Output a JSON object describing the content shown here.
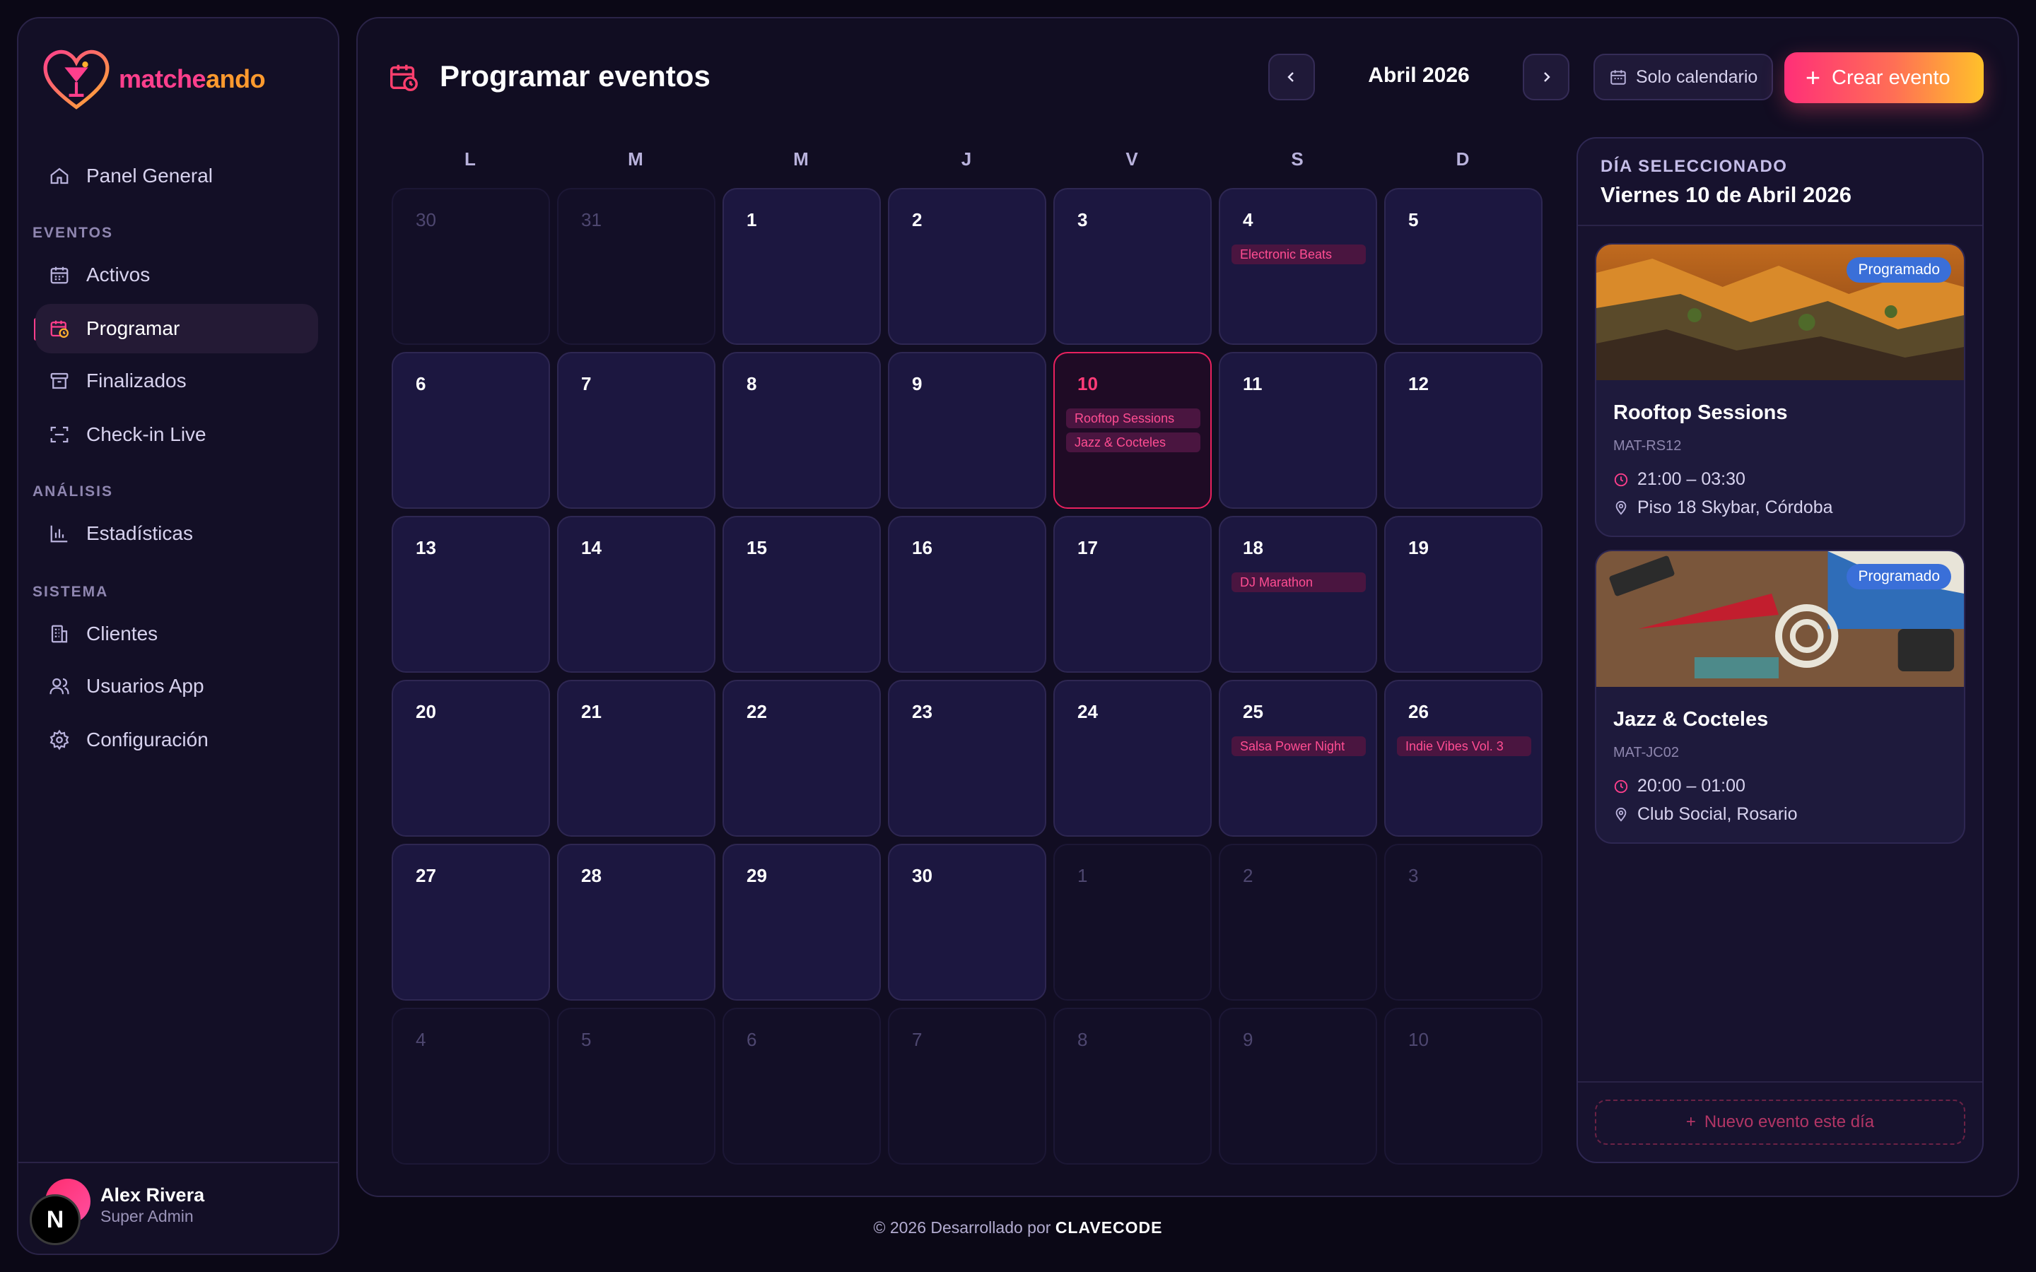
{
  "brand": {
    "name_main": "matche",
    "name_tail": "ando"
  },
  "sidebar": {
    "main_item": "Panel General",
    "sections": [
      {
        "title": "EVENTOS",
        "items": [
          "Activos",
          "Programar",
          "Finalizados",
          "Check-in Live"
        ]
      },
      {
        "title": "ANÁLISIS",
        "items": [
          "Estadísticas"
        ]
      },
      {
        "title": "SISTEMA",
        "items": [
          "Clientes",
          "Usuarios App",
          "Configuración"
        ]
      }
    ],
    "active_item": "Programar",
    "user": {
      "name": "Alex Rivera",
      "role": "Super Admin",
      "badge": "N"
    }
  },
  "header": {
    "title": "Programar eventos",
    "month": "Abril 2026",
    "solo_label": "Solo calendario",
    "create_label": "Crear evento"
  },
  "calendar": {
    "weekdays": [
      "L",
      "M",
      "M",
      "J",
      "V",
      "S",
      "D"
    ],
    "weeks": [
      [
        {
          "n": "30",
          "o": true
        },
        {
          "n": "31",
          "o": true
        },
        {
          "n": "1"
        },
        {
          "n": "2"
        },
        {
          "n": "3"
        },
        {
          "n": "4",
          "events": [
            "Electronic Beats"
          ]
        },
        {
          "n": "5"
        }
      ],
      [
        {
          "n": "6"
        },
        {
          "n": "7"
        },
        {
          "n": "8"
        },
        {
          "n": "9"
        },
        {
          "n": "10",
          "sel": true,
          "events": [
            "Rooftop Sessions",
            "Jazz & Cocteles"
          ]
        },
        {
          "n": "11"
        },
        {
          "n": "12"
        }
      ],
      [
        {
          "n": "13"
        },
        {
          "n": "14"
        },
        {
          "n": "15"
        },
        {
          "n": "16"
        },
        {
          "n": "17"
        },
        {
          "n": "18",
          "events": [
            "DJ Marathon"
          ]
        },
        {
          "n": "19"
        }
      ],
      [
        {
          "n": "20"
        },
        {
          "n": "21"
        },
        {
          "n": "22"
        },
        {
          "n": "23"
        },
        {
          "n": "24"
        },
        {
          "n": "25",
          "events": [
            "Salsa Power Night"
          ]
        },
        {
          "n": "26",
          "events": [
            "Indie Vibes Vol. 3"
          ]
        }
      ],
      [
        {
          "n": "27"
        },
        {
          "n": "28"
        },
        {
          "n": "29"
        },
        {
          "n": "30"
        },
        {
          "n": "1",
          "o": true
        },
        {
          "n": "2",
          "o": true
        },
        {
          "n": "3",
          "o": true
        }
      ],
      [
        {
          "n": "4",
          "o": true
        },
        {
          "n": "5",
          "o": true
        },
        {
          "n": "6",
          "o": true
        },
        {
          "n": "7",
          "o": true
        },
        {
          "n": "8",
          "o": true
        },
        {
          "n": "9",
          "o": true
        },
        {
          "n": "10",
          "o": true
        }
      ]
    ]
  },
  "selected_day": {
    "kicker": "DÍA SELECCIONADO",
    "date": "Viernes 10 de Abril 2026",
    "events": [
      {
        "badge": "Programado",
        "title": "Rooftop Sessions",
        "code": "MAT-RS12",
        "time": "21:00 – 03:30",
        "place": "Piso 18 Skybar, Córdoba"
      },
      {
        "badge": "Programado",
        "title": "Jazz & Cocteles",
        "code": "MAT-JC02",
        "time": "20:00 – 01:00",
        "place": "Club Social, Rosario"
      }
    ],
    "new_event_label": "Nuevo evento este día"
  },
  "footer": {
    "prefix": "© 2026 Desarrollado por",
    "company": "CLAVECODE"
  },
  "colors": {
    "accent": "#ff3f8c",
    "badge": "#3a6fd8",
    "bg": "#0b0816"
  }
}
